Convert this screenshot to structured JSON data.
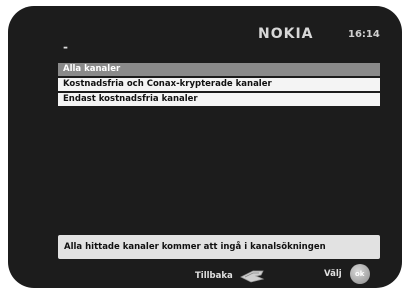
{
  "header": {
    "brand": "NOKIA",
    "time": "16:14",
    "title": "-"
  },
  "menu": {
    "items": [
      {
        "label": "Alla kanaler",
        "selected": true
      },
      {
        "label": "Kostnadsfria och Conax-krypterade kanaler",
        "selected": false
      },
      {
        "label": "Endast kostnadsfria kanaler",
        "selected": false
      }
    ]
  },
  "info": {
    "text": "Alla hittade kanaler kommer att ingå i kanalsökningen"
  },
  "footer": {
    "back_label": "Tillbaka",
    "back_icon": "back-arrow-icon",
    "ok_label": "Välj",
    "ok_icon_text": "ok"
  },
  "colors": {
    "screen_bg": "#1c1c1c",
    "selected_item": "#8a8a8a",
    "item_bg": "#f4f4f4",
    "info_bg": "#e2e2e2"
  }
}
